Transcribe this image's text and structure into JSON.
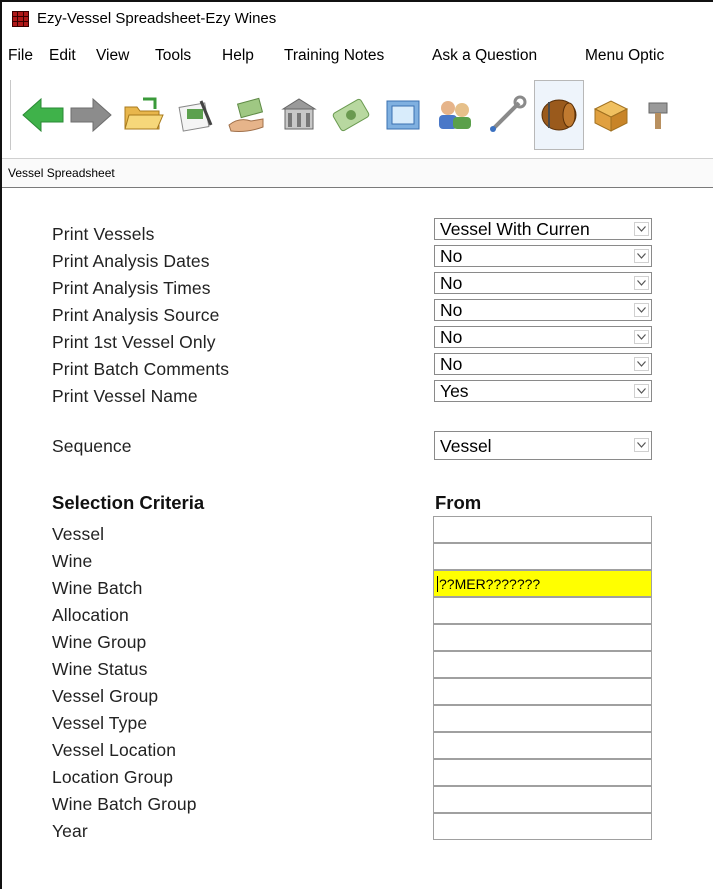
{
  "window": {
    "title": "Ezy-Vessel Spreadsheet-Ezy Wines"
  },
  "menu": [
    "File",
    "Edit",
    "View",
    "Tools",
    "Help",
    "Training Notes",
    "Ask a Question",
    "Menu Optic"
  ],
  "toolbar": {
    "icons": [
      "back-arrow-icon",
      "forward-arrow-icon",
      "open-folder-icon",
      "pen-document-icon",
      "hand-money-icon",
      "building-icon",
      "banknote-icon",
      "stamp-icon",
      "people-icon",
      "wrench-icon",
      "barrel-icon",
      "box-icon",
      "tool-icon"
    ]
  },
  "tab": {
    "label": "Vessel Spreadsheet"
  },
  "options": [
    {
      "label": "Print Vessels",
      "value": "Vessel With Curren"
    },
    {
      "label": "Print Analysis Dates",
      "value": "No"
    },
    {
      "label": "Print Analysis Times",
      "value": "No"
    },
    {
      "label": "Print Analysis Source",
      "value": "No"
    },
    {
      "label": "Print 1st Vessel Only",
      "value": "No"
    },
    {
      "label": "Print Batch Comments",
      "value": "No"
    },
    {
      "label": "Print Vessel Name",
      "value": "Yes"
    }
  ],
  "sequence": {
    "label": "Sequence",
    "value": "Vessel"
  },
  "criteria": {
    "heading": "Selection Criteria",
    "from_heading": "From",
    "fields": [
      {
        "label": "Vessel",
        "value": ""
      },
      {
        "label": "Wine",
        "value": ""
      },
      {
        "label": "Wine Batch",
        "value": "??MER???????"
      },
      {
        "label": "Allocation",
        "value": ""
      },
      {
        "label": "Wine Group",
        "value": ""
      },
      {
        "label": "Wine Status",
        "value": ""
      },
      {
        "label": "Vessel Group",
        "value": ""
      },
      {
        "label": "Vessel Type",
        "value": ""
      },
      {
        "label": "Vessel Location",
        "value": ""
      },
      {
        "label": "Location Group",
        "value": ""
      },
      {
        "label": "Wine Batch Group",
        "value": ""
      },
      {
        "label": "Year",
        "value": ""
      }
    ]
  },
  "colors": {
    "highlight": "#ffff00",
    "arrow_green": "#3fb24a",
    "arrow_gray": "#8c8c8c"
  }
}
